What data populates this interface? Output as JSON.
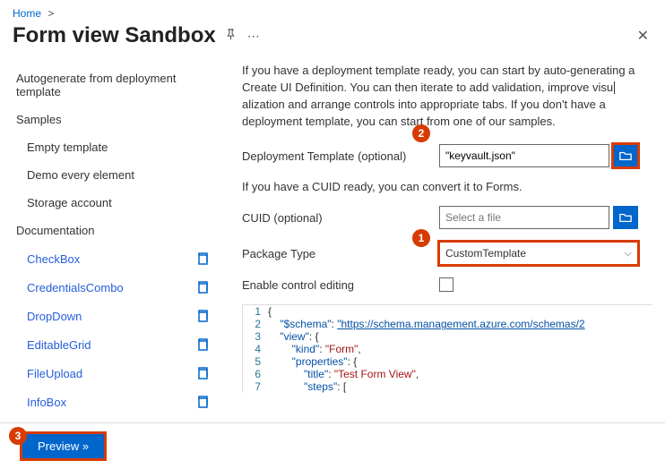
{
  "breadcrumb": {
    "home": "Home",
    "sep": ">"
  },
  "header": {
    "title": "Form view Sandbox"
  },
  "sidebar": {
    "autogen": "Autogenerate from deployment template",
    "samples_header": "Samples",
    "samples": [
      "Empty template",
      "Demo every element",
      "Storage account"
    ],
    "docs_header": "Documentation",
    "docs": [
      "CheckBox",
      "CredentialsCombo",
      "DropDown",
      "EditableGrid",
      "FileUpload",
      "InfoBox"
    ]
  },
  "main": {
    "intro": "If you have a deployment template ready, you can start by auto-generating a Create UI Definition. You can then iterate to add validation, improve visualization and arrange controls into appropriate tabs. If you don't have a deployment template, you can start from one of our samples.",
    "deploy_label": "Deployment Template (optional)",
    "deploy_value": "\"keyvault.json\"",
    "cuid_note": "If you have a CUID ready, you can convert it to Forms.",
    "cuid_label": "CUID (optional)",
    "cuid_placeholder": "Select a file",
    "pkg_label": "Package Type",
    "pkg_value": "CustomTemplate",
    "enable_label": "Enable control editing"
  },
  "code": {
    "l1": "{",
    "l2a": "    \"$schema\"",
    "l2b": ": ",
    "l2c": "\"https://schema.management.azure.com/schemas/2",
    "l3a": "    \"view\"",
    "l3b": ": {",
    "l4a": "        \"kind\"",
    "l4b": ": ",
    "l4c": "\"Form\"",
    "l4d": ",",
    "l5a": "        \"properties\"",
    "l5b": ": {",
    "l6a": "            \"title\"",
    "l6b": ": ",
    "l6c": "\"Test Form View\"",
    "l6d": ",",
    "l7a": "            \"steps\"",
    "l7b": ": ["
  },
  "footer": {
    "preview": "Preview »"
  },
  "callouts": {
    "c1": "1",
    "c2": "2",
    "c3": "3"
  }
}
